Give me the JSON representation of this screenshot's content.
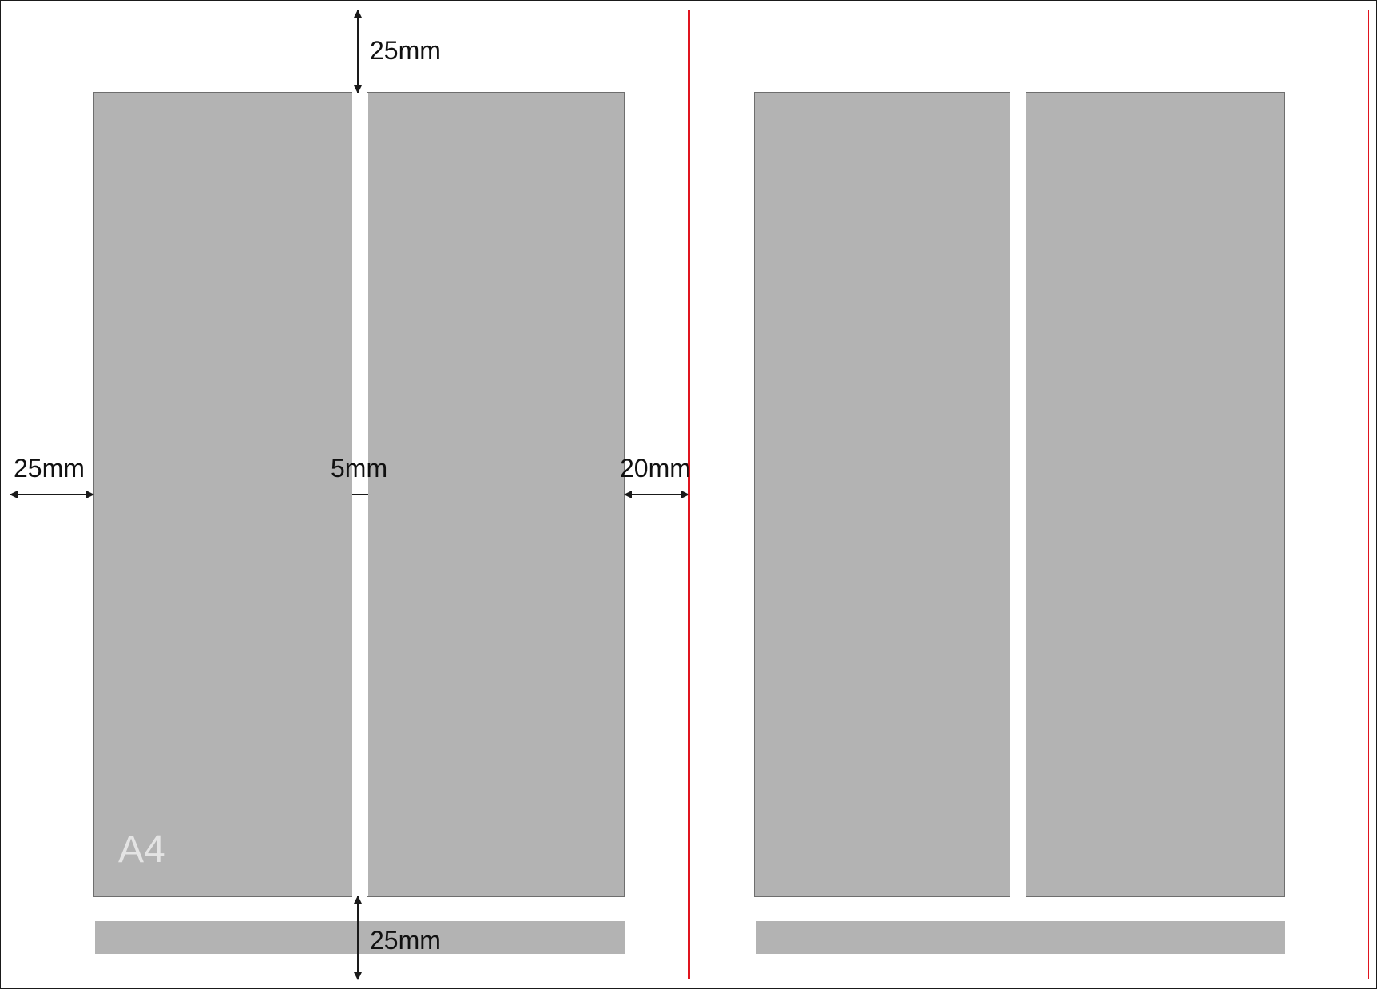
{
  "paper": {
    "label": "A4"
  },
  "colors": {
    "page_border": "#e0141e",
    "column_fill": "#b3b3b3",
    "column_stroke": "#6e6e6e",
    "gutter": "#ffffff",
    "arrow": "#1a1a1a",
    "text": "#111111",
    "paper_label": "#e4e4e4"
  },
  "dimensions": {
    "top_margin": "25mm",
    "bottom_margin": "25mm",
    "left_margin": "25mm",
    "right_margin": "20mm",
    "gutter": "5mm"
  },
  "pages": [
    {
      "name": "left-page",
      "columns": 2,
      "has_footer": true
    },
    {
      "name": "right-page",
      "columns": 2,
      "has_footer": true
    }
  ]
}
